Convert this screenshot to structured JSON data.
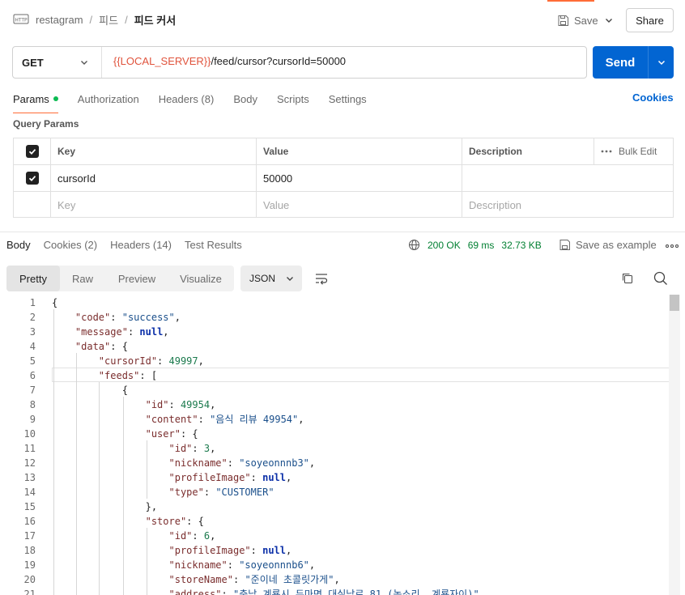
{
  "header": {
    "breadcrumb": [
      "restagram",
      "피드",
      "피드 커서"
    ],
    "save_label": "Save",
    "share_label": "Share"
  },
  "request": {
    "method": "GET",
    "url_variable": "{{LOCAL_SERVER}}",
    "url_path": "/feed/cursor?cursorId=50000",
    "send_label": "Send"
  },
  "req_tabs": [
    "Params",
    "Authorization",
    "Headers (8)",
    "Body",
    "Scripts",
    "Settings"
  ],
  "cookies_label": "Cookies",
  "query_params": {
    "title": "Query Params",
    "headers": [
      "Key",
      "Value",
      "Description"
    ],
    "bulk_edit": "Bulk Edit",
    "rows": [
      {
        "key": "cursorId",
        "value": "50000",
        "description": ""
      }
    ],
    "placeholders": {
      "key": "Key",
      "value": "Value",
      "description": "Description"
    }
  },
  "response": {
    "tabs": [
      "Body",
      "Cookies (2)",
      "Headers (14)",
      "Test Results"
    ],
    "status": "200 OK",
    "time": "69 ms",
    "size": "32.73 KB",
    "save_example": "Save as example",
    "view_tabs": [
      "Pretty",
      "Raw",
      "Preview",
      "Visualize"
    ],
    "format": "JSON"
  },
  "colors": {
    "accent": "#ff6c37",
    "primary": "#0265d2",
    "success": "#007f31",
    "variable": "#e0533c"
  },
  "code_lines": [
    "{",
    "    \"code\": \"success\",",
    "    \"message\": null,",
    "    \"data\": {",
    "        \"cursorId\": 49997,",
    "        \"feeds\": [",
    "            {",
    "                \"id\": 49954,",
    "                \"content\": \"음식 리뷰 49954\",",
    "                \"user\": {",
    "                    \"id\": 3,",
    "                    \"nickname\": \"soyeonnnb3\",",
    "                    \"profileImage\": null,",
    "                    \"type\": \"CUSTOMER\"",
    "                },",
    "                \"store\": {",
    "                    \"id\": 6,",
    "                    \"profileImage\": null,",
    "                    \"nickname\": \"soyeonnnb6\",",
    "                    \"storeName\": \"준이네 초콜릿가게\",",
    "                    \"address\": \"충남 계룡시 두마면 대실남로 81 (농소리, 계룡자이)\","
  ]
}
